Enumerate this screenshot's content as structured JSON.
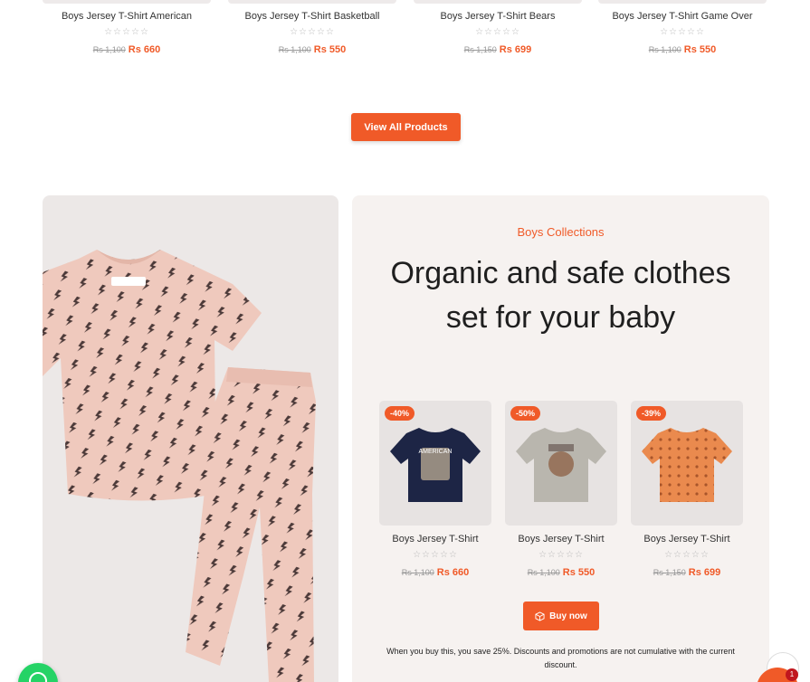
{
  "top_products": [
    {
      "title": "Boys Jersey T-Shirt American",
      "old_price": "Rs 1,100",
      "price": "Rs 660"
    },
    {
      "title": "Boys Jersey T-Shirt Basketball",
      "old_price": "Rs 1,100",
      "price": "Rs 550"
    },
    {
      "title": "Boys Jersey T-Shirt Bears",
      "old_price": "Rs 1,150",
      "price": "Rs 699"
    },
    {
      "title": "Boys Jersey T-Shirt Game Over",
      "old_price": "Rs 1,100",
      "price": "Rs 550"
    }
  ],
  "stars": "☆☆☆☆☆",
  "view_all_label": "View All Products",
  "collection": {
    "kicker": "Boys Collections",
    "headline": "Organic and safe clothes set for your baby",
    "products": [
      {
        "badge": "-40%",
        "title": "Boys Jersey T-Shirt",
        "old_price": "Rs 1,100",
        "price": "Rs 660",
        "shirt_color": "#1d2545"
      },
      {
        "badge": "-50%",
        "title": "Boys Jersey T-Shirt",
        "old_price": "Rs 1,100",
        "price": "Rs 550",
        "shirt_color": "#b9b6ae"
      },
      {
        "badge": "-39%",
        "title": "Boys Jersey T-Shirt",
        "old_price": "Rs 1,150",
        "price": "Rs 699",
        "shirt_color": "#ea8a4e"
      }
    ],
    "buy_now_label": "Buy now",
    "note": "When you buy this, you save 25%. Discounts and promotions are not cumulative with the current discount."
  },
  "cart_count": "1",
  "colors": {
    "accent": "#f05a28",
    "pajama": "#efc9bd"
  }
}
